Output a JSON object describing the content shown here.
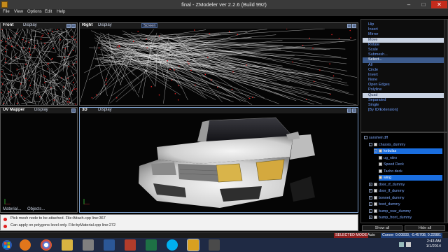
{
  "window": {
    "title": "final - ZModeler ver 2.2.6 (Build 992)"
  },
  "menu": [
    "File",
    "View",
    "Options",
    "Edit",
    "Help"
  ],
  "viewports": {
    "front": {
      "name": "Front",
      "display": "Display"
    },
    "right": {
      "name": "Right",
      "display": "Display",
      "dropdown": "Screen"
    },
    "uv": {
      "name": "UV Mapper",
      "display": "Display",
      "tabs": [
        "Material...",
        "Objects..."
      ]
    },
    "view3d": {
      "name": "3D",
      "display": "Display"
    }
  },
  "commands": [
    "Hip",
    "Insert",
    "Mirror",
    "Move",
    "Rotate",
    "Scale",
    "Submesh...",
    "Select...",
    "All",
    "Circle",
    "Invert",
    "None",
    "Open Edges",
    "Polyline",
    "Quad",
    "Separated",
    "Single",
    "[By ID/Extension]"
  ],
  "commands_highlighted": [
    3,
    14
  ],
  "commands_header": 7,
  "tree": {
    "items": [
      {
        "label": "sansheir.dff",
        "depth": 0,
        "check": false,
        "expand": "-"
      },
      {
        "label": "chassis_dummy",
        "depth": 1,
        "check": true,
        "expand": "-"
      },
      {
        "label": "kebulas",
        "depth": 2,
        "check": true,
        "expand": "-",
        "selected": true
      },
      {
        "label": "ug_nitro",
        "depth": 3,
        "check": true
      },
      {
        "label": "Speed Deck",
        "depth": 3,
        "check": true
      },
      {
        "label": "Tacho deck",
        "depth": 3,
        "check": true
      },
      {
        "label": "wing",
        "depth": 3,
        "check": true,
        "selected": true
      },
      {
        "label": "door_rf_dummy",
        "depth": 1,
        "check": true,
        "expand": "+"
      },
      {
        "label": "door_lf_dummy",
        "depth": 1,
        "check": true,
        "expand": "+"
      },
      {
        "label": "bonnet_dummy",
        "depth": 1,
        "check": true,
        "expand": "+"
      },
      {
        "label": "boot_dummy",
        "depth": 1,
        "check": true,
        "expand": "+"
      },
      {
        "label": "bump_rear_dummy",
        "depth": 1,
        "check": true,
        "expand": "+"
      },
      {
        "label": "bump_front_dummy",
        "depth": 1,
        "check": true,
        "expand": "+"
      }
    ],
    "show_all": "Show all",
    "hide_all": "Hide all"
  },
  "log": [
    "Pick mesh node to be attached. File:Attach.cpp line:367",
    "Can apply on polygons level only. File:byMaterial.cpp line:272"
  ],
  "status": {
    "mode": "SELECTED MODE",
    "auto": "Auto",
    "cursor": "Cursor: 0.00833, -0.45708, 0.22881"
  },
  "clock": {
    "time": "2:43 AM",
    "date": "1/1/2014"
  },
  "colors": {
    "accent": "#1a6ee0",
    "list_text": "#6f9fff",
    "close": "#c42b1c"
  }
}
